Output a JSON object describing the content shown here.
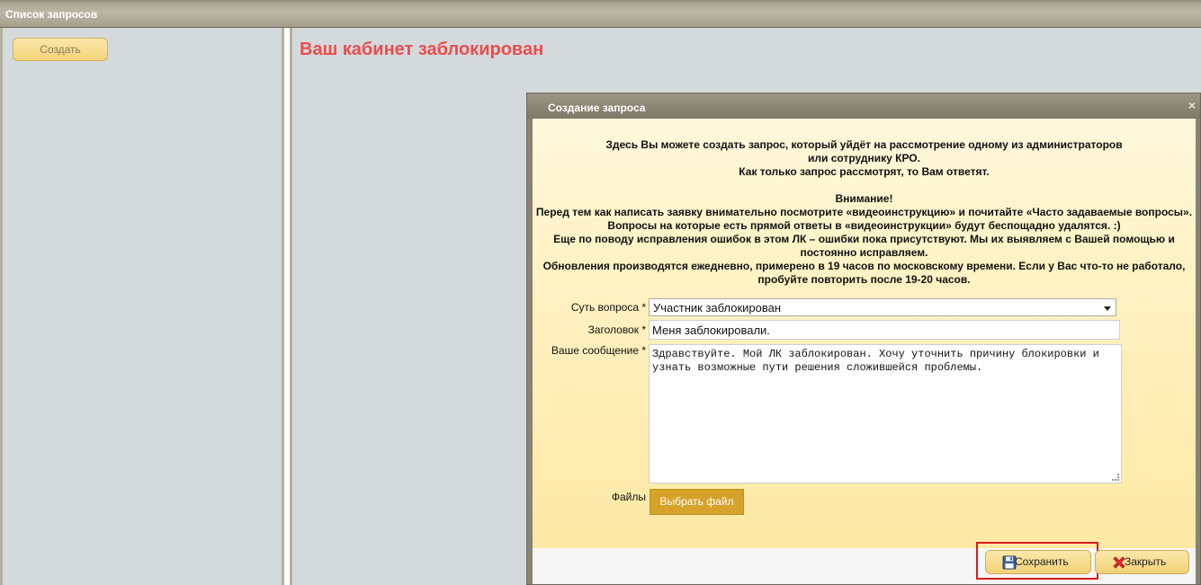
{
  "topbar": {
    "title": "Список запросов"
  },
  "sidebar": {
    "create_label": "Создать"
  },
  "main": {
    "blocked_title": "Ваш кабинет заблокирован"
  },
  "dialog": {
    "title": "Создание запроса",
    "close_glyph": "×",
    "intro_lines": [
      "Здесь Вы можете создать запрос, который уйдёт на рассмотрение одному из администраторов",
      "или сотруднику КРО.",
      "Как только запрос рассмотрят, то Вам ответят.",
      "",
      "Внимание!",
      "Перед тем как написать заявку внимательно посмотрите «видеоинструкцию» и почитайте «Часто задаваемые вопросы».",
      "Вопросы на которые есть прямой ответы в «видеоинструкции» будут беспощадно удалятся. :)",
      "Еще по поводу исправления ошибок в этом ЛК – ошибки пока присутствуют. Мы их выявляем с Вашей помощью и постоянно исправляем.",
      "Обновления производятся ежедневно, примерено в 19 часов по московскому времени. Если у Вас что-то не работало, пробуйте повторить после 19-20 часов."
    ],
    "form": {
      "topic_label": "Суть вопроса *",
      "topic_value": "Участник заблокирован",
      "title_label": "Заголовок *",
      "title_value": "Меня заблокировали.",
      "message_label": "Ваше сообщение *",
      "message_value": "Здравствуйте. Мой ЛК заблокирован. Хочу уточнить причину блокировки и узнать возможные пути решения сложившейся проблемы.",
      "files_label": "Файлы",
      "file_button": "Выбрать файл"
    },
    "footer": {
      "save_label": "Сохранить",
      "close_label": "Закрыть"
    }
  },
  "icons": {
    "save": "floppy-disk-icon",
    "close": "red-x-icon"
  },
  "colors": {
    "blocked_title": "#e84d4d",
    "highlight": "#d81b1b",
    "file_button": "#d6a22a"
  }
}
